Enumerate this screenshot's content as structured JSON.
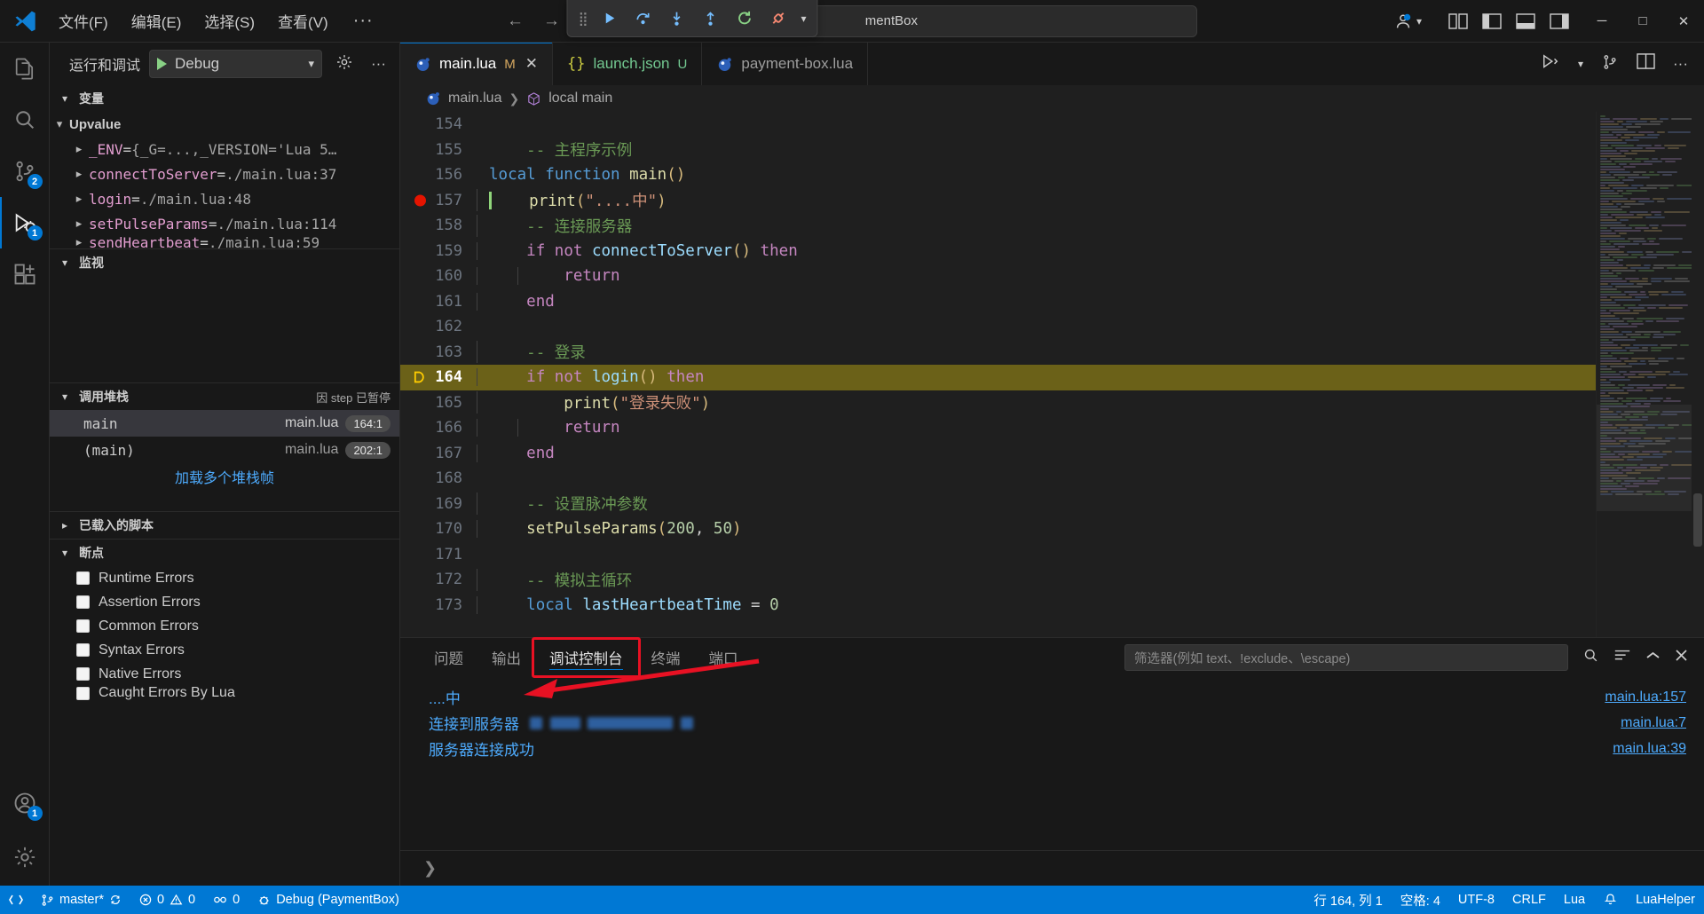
{
  "titlebar": {
    "menus": [
      "文件(F)",
      "编辑(E)",
      "选择(S)",
      "查看(V)"
    ],
    "more": "···",
    "command_center_text": "mentBox",
    "debug_toolbar": {
      "continue": "继续",
      "step_over": "单步跳过",
      "step_into": "单步调试",
      "step_out": "单步跳出",
      "restart": "重启",
      "disconnect": "断开连接"
    },
    "window_controls": {
      "minimize": "─",
      "maximize": "□",
      "close": "✕"
    }
  },
  "activitybar": {
    "items": [
      {
        "name": "explorer",
        "badge": ""
      },
      {
        "name": "search",
        "badge": ""
      },
      {
        "name": "source-control",
        "badge": "2"
      },
      {
        "name": "run-and-debug",
        "badge": ""
      },
      {
        "name": "extensions",
        "badge": ""
      }
    ],
    "bottom": [
      {
        "name": "accounts",
        "badge": "1"
      },
      {
        "name": "settings",
        "badge": ""
      }
    ],
    "debug_badge": "1"
  },
  "sidebar": {
    "title": "运行和调试",
    "launch_config": "Debug",
    "sections": {
      "variables": {
        "label": "变量",
        "scope": "Upvalue",
        "rows": [
          {
            "name": "_ENV",
            "value": "{_G=...,_VERSION='Lua 5…"
          },
          {
            "name": "connectToServer",
            "value": "./main.lua:37"
          },
          {
            "name": "login",
            "value": "./main.lua:48"
          },
          {
            "name": "setPulseParams",
            "value": "./main.lua:114"
          },
          {
            "name": "sendHeartbeat",
            "value": "./main.lua:59"
          }
        ]
      },
      "watch": {
        "label": "监视"
      },
      "callstack": {
        "label": "调用堆栈",
        "status": "因 step 已暂停",
        "frames": [
          {
            "name": "main",
            "source": "main.lua",
            "position": "164:1",
            "selected": true
          },
          {
            "name": "(main)",
            "source": "main.lua",
            "position": "202:1",
            "selected": false
          }
        ],
        "load_more": "加载多个堆栈帧"
      },
      "loaded_scripts": {
        "label": "已载入的脚本"
      },
      "breakpoints": {
        "label": "断点",
        "items": [
          {
            "label": "Runtime Errors",
            "checked": false
          },
          {
            "label": "Assertion Errors",
            "checked": false
          },
          {
            "label": "Common Errors",
            "checked": false
          },
          {
            "label": "Syntax Errors",
            "checked": false
          },
          {
            "label": "Native Errors",
            "checked": false
          },
          {
            "label": "Caught Errors By Lua",
            "checked": false
          }
        ]
      }
    }
  },
  "editor": {
    "tabs": [
      {
        "label": "main.lua",
        "modified": "M",
        "active": true,
        "icon": "lua-icon"
      },
      {
        "label": "launch.json",
        "modified": "U",
        "active": false,
        "icon": "json-icon"
      },
      {
        "label": "payment-box.lua",
        "modified": "",
        "active": false,
        "icon": "lua-icon"
      }
    ],
    "breadcrumb": [
      "main.lua",
      "local main"
    ],
    "first_line": 154,
    "current_line": 164,
    "breakpoint_line": 157,
    "lines": [
      {
        "n": 154,
        "tokens": []
      },
      {
        "n": 155,
        "tokens": [
          {
            "t": "    ",
            "c": "pl"
          },
          {
            "t": "-- 主程序示例",
            "c": "cm"
          }
        ]
      },
      {
        "n": 156,
        "tokens": [
          {
            "t": "",
            "c": "pl"
          },
          {
            "t": "local",
            "c": "k"
          },
          {
            "t": " ",
            "c": "pl"
          },
          {
            "t": "function",
            "c": "k"
          },
          {
            "t": " ",
            "c": "pl"
          },
          {
            "t": "main",
            "c": "fn"
          },
          {
            "t": "()",
            "c": "pn"
          }
        ]
      },
      {
        "n": 157,
        "tokens": [
          {
            "t": "    ",
            "c": "pl"
          },
          {
            "t": "print",
            "c": "fn"
          },
          {
            "t": "(",
            "c": "pn"
          },
          {
            "t": "\"....中\"",
            "c": "st"
          },
          {
            "t": ")",
            "c": "pn"
          }
        ]
      },
      {
        "n": 158,
        "tokens": [
          {
            "t": "    ",
            "c": "pl"
          },
          {
            "t": "-- 连接服务器",
            "c": "cm"
          }
        ]
      },
      {
        "n": 159,
        "tokens": [
          {
            "t": "    ",
            "c": "pl"
          },
          {
            "t": "if",
            "c": "kw"
          },
          {
            "t": " ",
            "c": "pl"
          },
          {
            "t": "not",
            "c": "kw"
          },
          {
            "t": " ",
            "c": "pl"
          },
          {
            "t": "connectToServer",
            "c": "id"
          },
          {
            "t": "()",
            "c": "pn"
          },
          {
            "t": " ",
            "c": "pl"
          },
          {
            "t": "then",
            "c": "kw"
          }
        ]
      },
      {
        "n": 160,
        "tokens": [
          {
            "t": "        ",
            "c": "pl"
          },
          {
            "t": "return",
            "c": "kw"
          }
        ]
      },
      {
        "n": 161,
        "tokens": [
          {
            "t": "    ",
            "c": "pl"
          },
          {
            "t": "end",
            "c": "kw"
          }
        ]
      },
      {
        "n": 162,
        "tokens": []
      },
      {
        "n": 163,
        "tokens": [
          {
            "t": "    ",
            "c": "pl"
          },
          {
            "t": "-- 登录",
            "c": "cm"
          }
        ]
      },
      {
        "n": 164,
        "tokens": [
          {
            "t": "    ",
            "c": "pl"
          },
          {
            "t": "if",
            "c": "kw"
          },
          {
            "t": " ",
            "c": "pl"
          },
          {
            "t": "not",
            "c": "kw"
          },
          {
            "t": " ",
            "c": "pl"
          },
          {
            "t": "login",
            "c": "id"
          },
          {
            "t": "()",
            "c": "pn"
          },
          {
            "t": " ",
            "c": "pl"
          },
          {
            "t": "then",
            "c": "kw"
          }
        ]
      },
      {
        "n": 165,
        "tokens": [
          {
            "t": "        ",
            "c": "pl"
          },
          {
            "t": "print",
            "c": "fn"
          },
          {
            "t": "(",
            "c": "pn"
          },
          {
            "t": "\"登录失败\"",
            "c": "st"
          },
          {
            "t": ")",
            "c": "pn"
          }
        ]
      },
      {
        "n": 166,
        "tokens": [
          {
            "t": "        ",
            "c": "pl"
          },
          {
            "t": "return",
            "c": "kw"
          }
        ]
      },
      {
        "n": 167,
        "tokens": [
          {
            "t": "    ",
            "c": "pl"
          },
          {
            "t": "end",
            "c": "kw"
          }
        ]
      },
      {
        "n": 168,
        "tokens": []
      },
      {
        "n": 169,
        "tokens": [
          {
            "t": "    ",
            "c": "pl"
          },
          {
            "t": "-- 设置脉冲参数",
            "c": "cm"
          }
        ]
      },
      {
        "n": 170,
        "tokens": [
          {
            "t": "    ",
            "c": "pl"
          },
          {
            "t": "setPulseParams",
            "c": "fn"
          },
          {
            "t": "(",
            "c": "pn"
          },
          {
            "t": "200",
            "c": "nm"
          },
          {
            "t": ", ",
            "c": "pl"
          },
          {
            "t": "50",
            "c": "nm"
          },
          {
            "t": ")",
            "c": "pn"
          }
        ]
      },
      {
        "n": 171,
        "tokens": []
      },
      {
        "n": 172,
        "tokens": [
          {
            "t": "    ",
            "c": "pl"
          },
          {
            "t": "-- 模拟主循环",
            "c": "cm"
          }
        ]
      },
      {
        "n": 173,
        "tokens": [
          {
            "t": "    ",
            "c": "pl"
          },
          {
            "t": "local",
            "c": "k"
          },
          {
            "t": " ",
            "c": "pl"
          },
          {
            "t": "lastHeartbeatTime",
            "c": "id"
          },
          {
            "t": " = ",
            "c": "pl"
          },
          {
            "t": "0",
            "c": "nm"
          }
        ]
      }
    ]
  },
  "panel": {
    "tabs": [
      "问题",
      "输出",
      "调试控制台",
      "终端",
      "端口"
    ],
    "active_tab": "调试控制台",
    "filter_placeholder": "筛选器(例如 text、!exclude、\\escape)",
    "console_lines": [
      {
        "text": "....中",
        "source": "main.lua:157",
        "redacted": false
      },
      {
        "text": "连接到服务器",
        "source": "main.lua:7",
        "redacted": true
      },
      {
        "text": "服务器连接成功",
        "source": "main.lua:39",
        "redacted": false
      }
    ],
    "prompt": "❯"
  },
  "statusbar": {
    "left": [
      {
        "name": "remote",
        "label": ""
      },
      {
        "name": "branch",
        "label": "master*"
      },
      {
        "name": "sync",
        "label": ""
      },
      {
        "name": "problems",
        "label": "0  0"
      },
      {
        "name": "ports",
        "label": "0"
      },
      {
        "name": "debug-session",
        "label": "Debug (PaymentBox)"
      }
    ],
    "errors": "0",
    "warnings": "0",
    "ports": "0",
    "right": [
      {
        "name": "cursor-position",
        "label": "行 164, 列 1"
      },
      {
        "name": "indentation",
        "label": "空格: 4"
      },
      {
        "name": "encoding",
        "label": "UTF-8"
      },
      {
        "name": "eol",
        "label": "CRLF"
      },
      {
        "name": "language-mode",
        "label": "Lua"
      },
      {
        "name": "notifications",
        "label": ""
      },
      {
        "name": "lua-helper",
        "label": "LuaHelper"
      }
    ]
  },
  "colors": {
    "accent": "#0078d4",
    "breakpoint": "#e51400",
    "current_line": "#6b6118",
    "annotation": "#e81123",
    "link": "#4daafc"
  }
}
